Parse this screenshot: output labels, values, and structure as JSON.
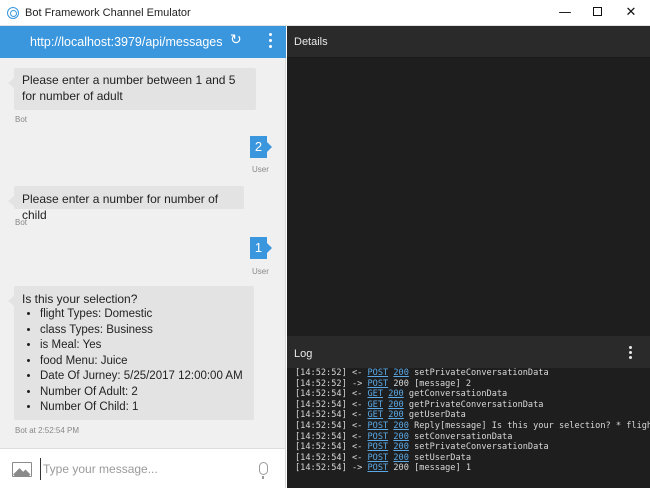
{
  "window": {
    "title": "Bot Framework Channel Emulator",
    "minimize": "—",
    "close": "✕"
  },
  "chat": {
    "endpoint": "http://localhost:3979/api/messages",
    "refresh_icon": "↻",
    "messages": [
      {
        "from": "bot",
        "text": "Please enter a number between 1 and 5 for number of adult",
        "sender": "Bot"
      },
      {
        "from": "user",
        "text": "2",
        "sender": "User"
      },
      {
        "from": "bot",
        "text": "Please enter a number for number of child",
        "sender": "Bot"
      },
      {
        "from": "user",
        "text": "1",
        "sender": "User"
      },
      {
        "from": "bot",
        "heading": "Is this your selection?",
        "items": [
          "flight Types: Domestic",
          "class Types: Business",
          "is Meal: Yes",
          "food Menu: Juice",
          "Date Of Jurney: 5/25/2017 12:00:00 AM",
          "Number Of Adult: 2",
          "Number Of Child: 1"
        ],
        "sender": "Bot at 2:52:54 PM"
      }
    ],
    "input_placeholder": "Type your message..."
  },
  "details": {
    "title": "Details"
  },
  "log": {
    "title": "Log",
    "entries": [
      {
        "time": "[14:52:52]",
        "dir": "<-",
        "verb": "POST",
        "status": "200",
        "status_link": true,
        "text": "setPrivateConversationData"
      },
      {
        "time": "[14:52:52]",
        "dir": "->",
        "verb": "POST",
        "status": "200",
        "status_link": false,
        "text": "[message] 2"
      },
      {
        "time": "[14:52:54]",
        "dir": "<-",
        "verb": "GET",
        "status": "200",
        "status_link": true,
        "text": "getConversationData"
      },
      {
        "time": "[14:52:54]",
        "dir": "<-",
        "verb": "GET",
        "status": "200",
        "status_link": true,
        "text": "getPrivateConversationData"
      },
      {
        "time": "[14:52:54]",
        "dir": "<-",
        "verb": "GET",
        "status": "200",
        "status_link": true,
        "text": "getUserData"
      },
      {
        "time": "[14:52:54]",
        "dir": "<-",
        "verb": "POST",
        "status": "200",
        "status_link": true,
        "text": "Reply[message] Is this your selection? * fligh"
      },
      {
        "time": "[14:52:54]",
        "dir": "<-",
        "verb": "POST",
        "status": "200",
        "status_link": true,
        "text": "setConversationData"
      },
      {
        "time": "[14:52:54]",
        "dir": "<-",
        "verb": "POST",
        "status": "200",
        "status_link": true,
        "text": "setPrivateConversationData"
      },
      {
        "time": "[14:52:54]",
        "dir": "<-",
        "verb": "POST",
        "status": "200",
        "status_link": true,
        "text": "setUserData"
      },
      {
        "time": "[14:52:54]",
        "dir": "->",
        "verb": "POST",
        "status": "200",
        "status_link": false,
        "text": "[message] 1"
      }
    ]
  },
  "colors": {
    "accent": "#3a96dd",
    "dark_panel": "#1e1e1e",
    "link": "#5aa9e6"
  }
}
